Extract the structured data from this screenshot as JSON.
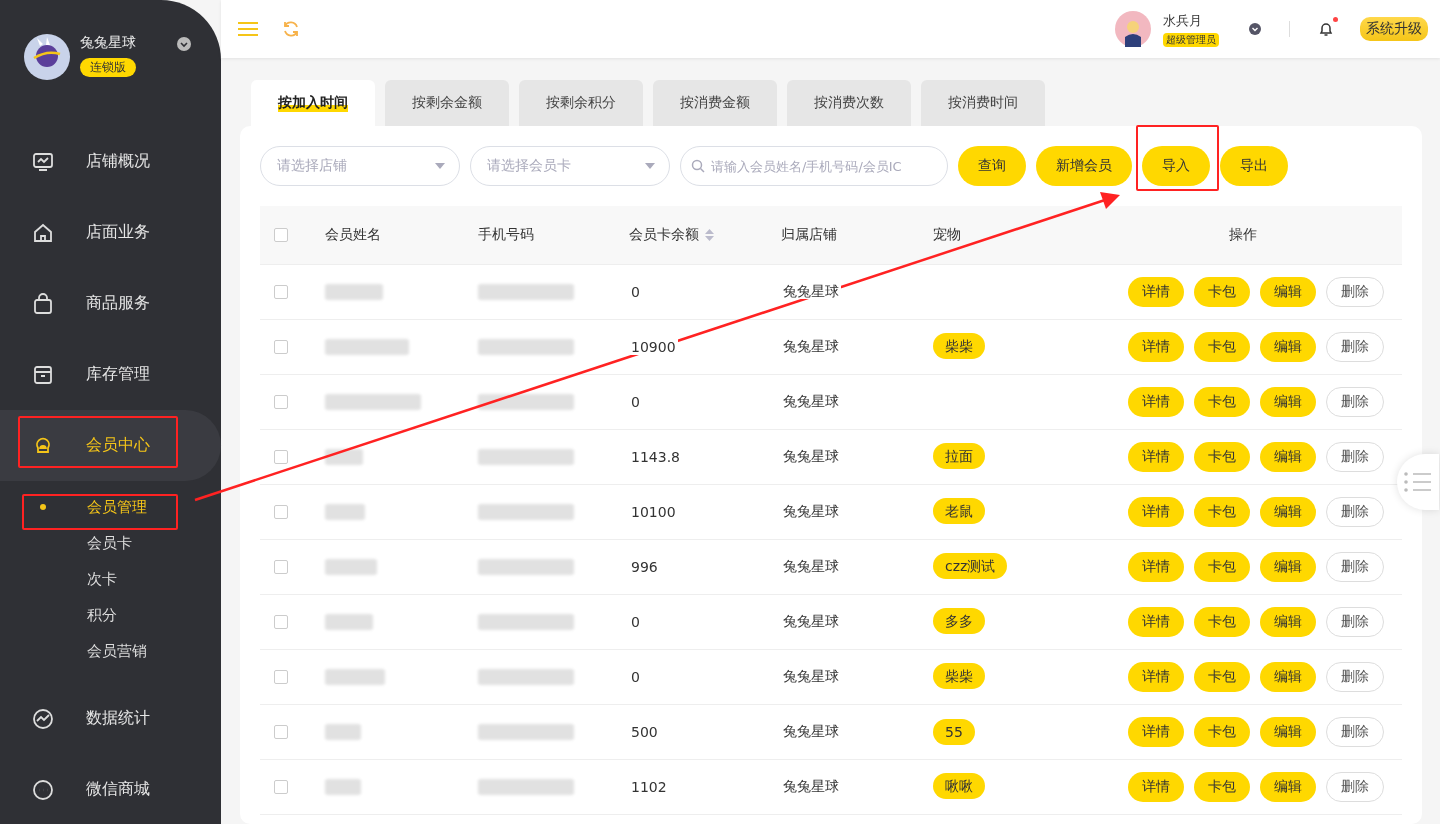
{
  "brand": {
    "name": "兔兔星球",
    "edition": "连锁版"
  },
  "sidebar": {
    "items": [
      {
        "label": "店铺概况",
        "selected": false
      },
      {
        "label": "店面业务",
        "selected": false
      },
      {
        "label": "商品服务",
        "selected": false
      },
      {
        "label": "库存管理",
        "selected": false
      },
      {
        "label": "会员中心",
        "selected": true,
        "children": [
          {
            "label": "会员管理",
            "selected": true
          },
          {
            "label": "会员卡",
            "selected": false
          },
          {
            "label": "次卡",
            "selected": false
          },
          {
            "label": "积分",
            "selected": false
          },
          {
            "label": "会员营销",
            "selected": false
          }
        ]
      },
      {
        "label": "数据统计",
        "selected": false
      },
      {
        "label": "微信商城",
        "selected": false
      }
    ]
  },
  "user": {
    "name": "水兵月",
    "role": "超级管理员",
    "has_notification": true,
    "upgrade": "系统升级"
  },
  "tabs": [
    {
      "label": "按加入时间",
      "selected": true
    },
    {
      "label": "按剩余金额",
      "selected": false
    },
    {
      "label": "按剩余积分",
      "selected": false
    },
    {
      "label": "按消费金额",
      "selected": false
    },
    {
      "label": "按消费次数",
      "selected": false
    },
    {
      "label": "按消费时间",
      "selected": false
    }
  ],
  "filters": {
    "store": {
      "placeholder": "请选择店铺"
    },
    "card": {
      "placeholder": "请选择会员卡"
    },
    "search": {
      "placeholder": "请输入会员姓名/手机号码/会员IC"
    }
  },
  "buttons": [
    "查询",
    "新增会员",
    "导入",
    "导出"
  ],
  "table": {
    "columns": [
      "会员姓名",
      "手机号码",
      "会员卡余额",
      "归属店铺",
      "宠物",
      "操作"
    ],
    "header_checked": false,
    "rows": [
      {
        "checked": false,
        "balance": "0",
        "store": "兔兔星球",
        "actions": [
          "详情",
          "卡包",
          "编辑",
          "删除"
        ]
      },
      {
        "checked": false,
        "balance": "10900",
        "store": "兔兔星球",
        "pet": "柴柴",
        "actions": [
          "详情",
          "卡包",
          "编辑",
          "删除"
        ]
      },
      {
        "checked": false,
        "balance": "0",
        "store": "兔兔星球",
        "actions": [
          "详情",
          "卡包",
          "编辑",
          "删除"
        ]
      },
      {
        "checked": false,
        "balance": "1143.8",
        "store": "兔兔星球",
        "pet": "拉面",
        "actions": [
          "详情",
          "卡包",
          "编辑",
          "删除"
        ]
      },
      {
        "checked": false,
        "balance": "10100",
        "store": "兔兔星球",
        "pet": "老鼠",
        "actions": [
          "详情",
          "卡包",
          "编辑",
          "删除"
        ]
      },
      {
        "checked": false,
        "balance": "996",
        "store": "兔兔星球",
        "pet": "czz测试",
        "actions": [
          "详情",
          "卡包",
          "编辑",
          "删除"
        ]
      },
      {
        "checked": false,
        "balance": "0",
        "store": "兔兔星球",
        "pet": "多多",
        "actions": [
          "详情",
          "卡包",
          "编辑",
          "删除"
        ]
      },
      {
        "checked": false,
        "balance": "0",
        "store": "兔兔星球",
        "pet": "柴柴",
        "actions": [
          "详情",
          "卡包",
          "编辑",
          "删除"
        ]
      },
      {
        "checked": false,
        "balance": "500",
        "store": "兔兔星球",
        "pet": "55",
        "actions": [
          "详情",
          "卡包",
          "编辑",
          "删除"
        ]
      },
      {
        "checked": false,
        "balance": "1102",
        "store": "兔兔星球",
        "pet": "啾啾",
        "actions": [
          "详情",
          "卡包",
          "编辑",
          "删除"
        ]
      }
    ]
  }
}
